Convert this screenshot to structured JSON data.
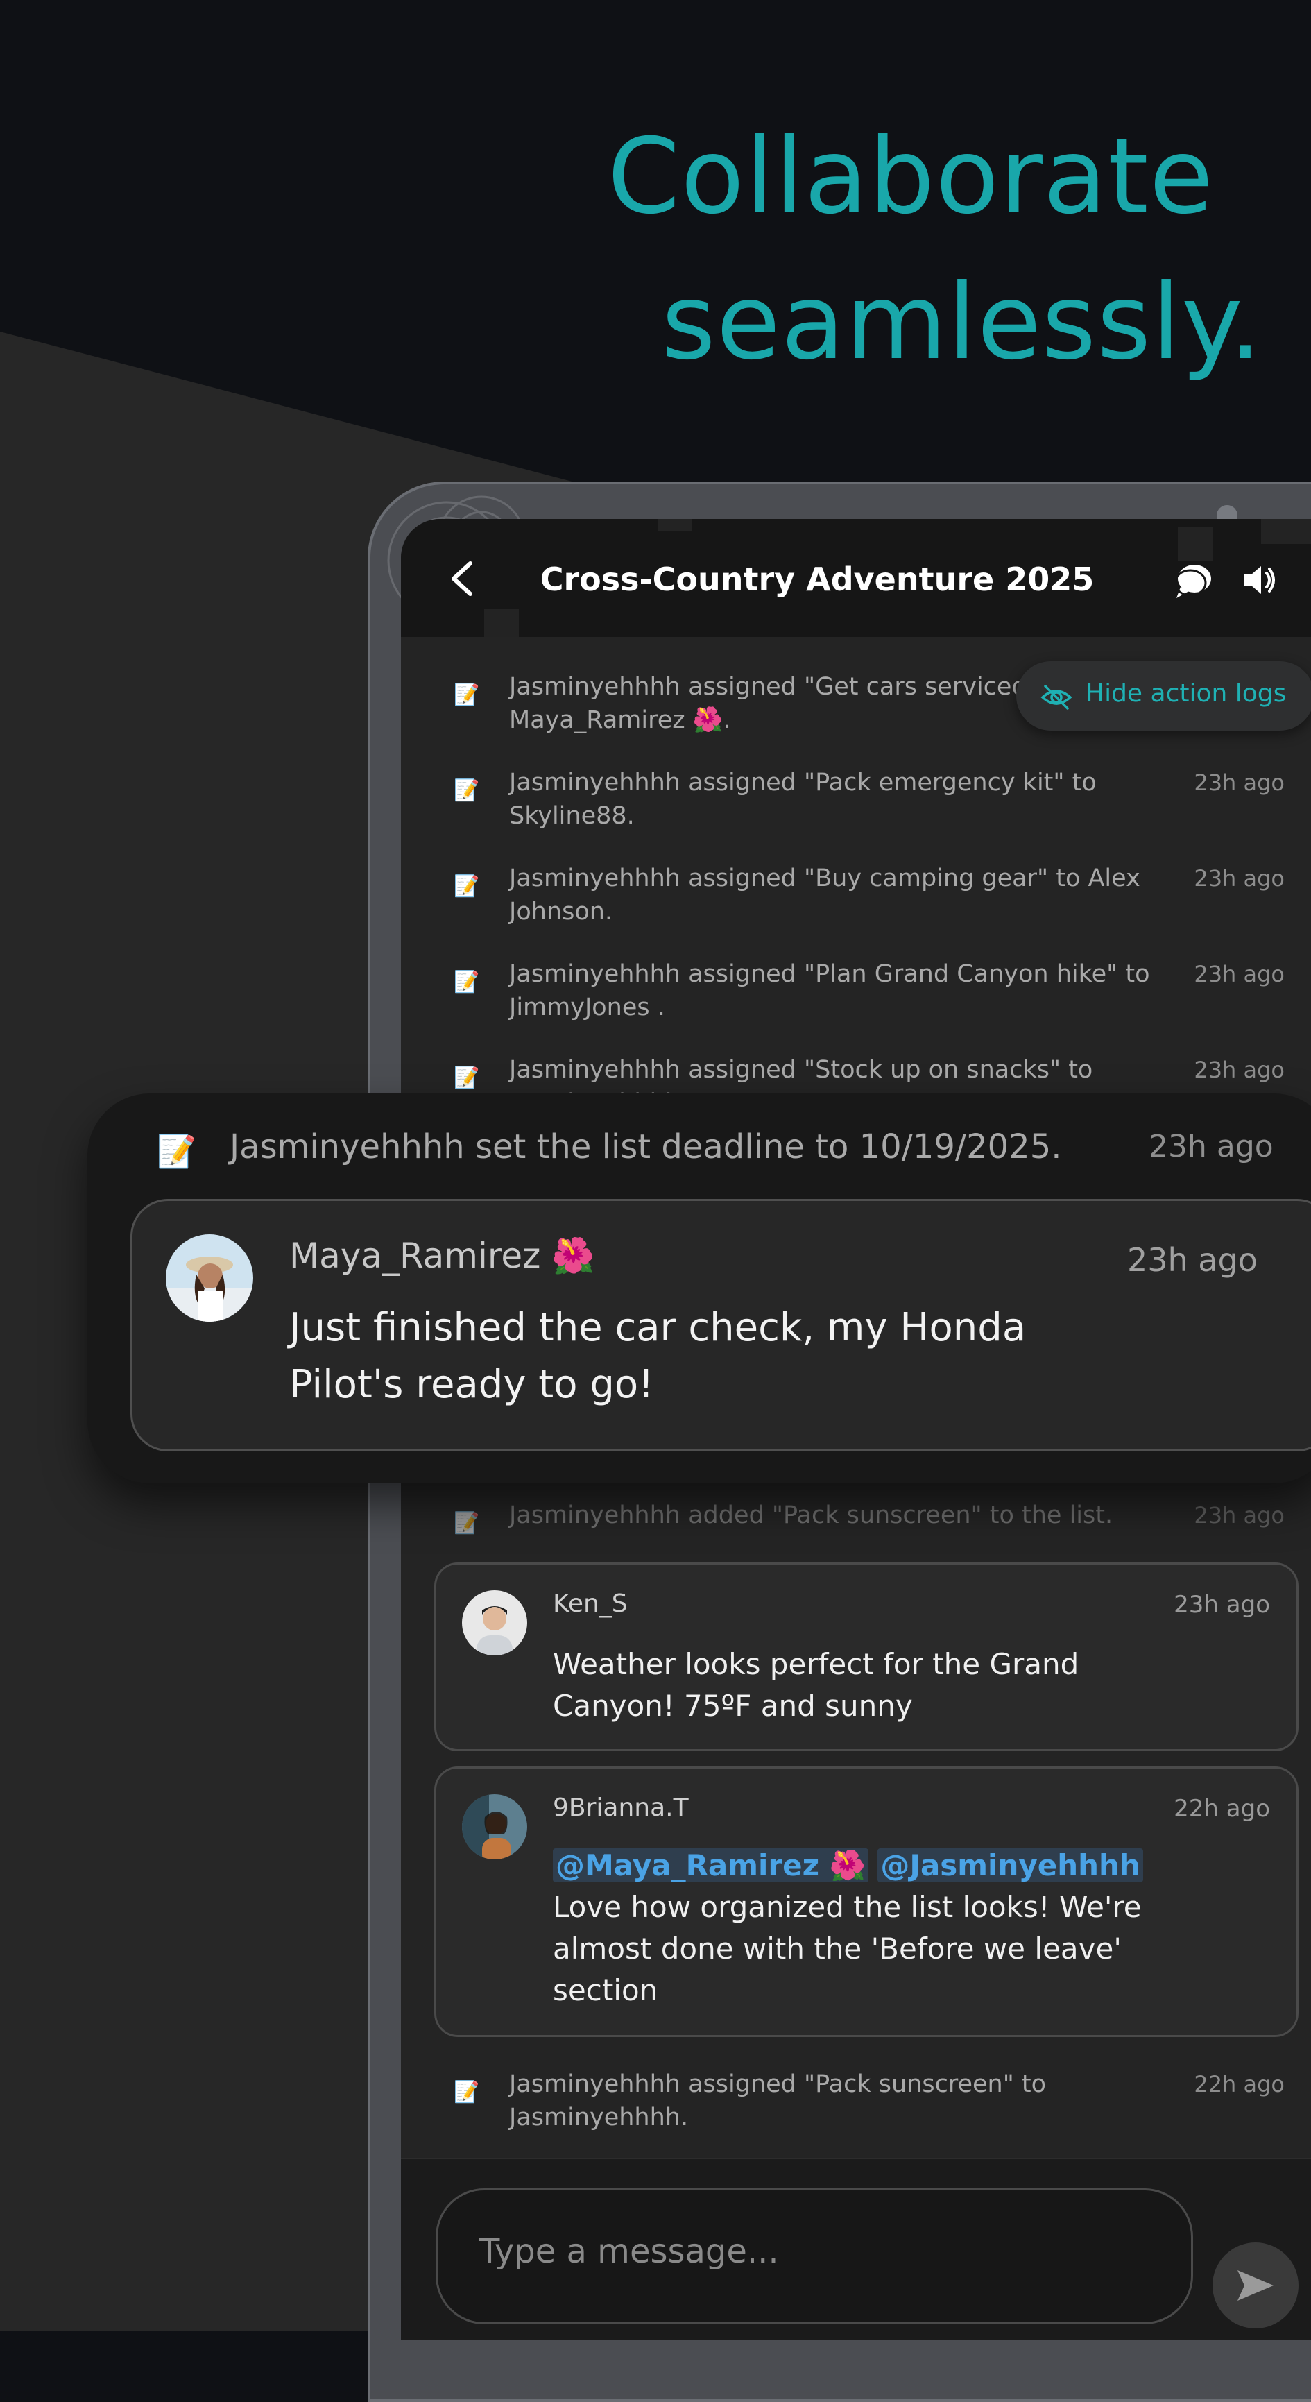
{
  "headline": {
    "line1": "Collaborate",
    "line2": "seamlessly."
  },
  "chat": {
    "title": "Cross-Country Adventure 2025",
    "hide_logs_label": "Hide action logs",
    "logs": [
      {
        "icon": "📝",
        "text": "Jasminyehhhh assigned \"Get cars serviced\" to Maya_Ramirez 🌺.",
        "time": ""
      },
      {
        "icon": "📝",
        "text": "Jasminyehhhh assigned \"Pack emergency kit\" to Skyline88.",
        "time": "23h ago"
      },
      {
        "icon": "📝",
        "text": "Jasminyehhhh assigned \"Buy camping gear\" to Alex Johnson.",
        "time": "23h ago"
      },
      {
        "icon": "📝",
        "text": "Jasminyehhhh assigned \"Plan Grand Canyon hike\" to JimmyJones .",
        "time": "23h ago"
      },
      {
        "icon": "📝",
        "text": "Jasminyehhhh assigned \"Stock up on snacks\" to Jasminyehhhh.",
        "time": "23h ago"
      }
    ],
    "zoom": {
      "log_icon": "📝",
      "log_text": "Jasminyehhhh set the list deadline to 10/19/2025.",
      "log_time": "23h ago",
      "user": "Maya_Ramirez 🌺",
      "time": "23h ago",
      "message": "Just finished the car check, my Honda Pilot's ready to go!"
    },
    "dim_log": {
      "icon": "📝",
      "text": "Jasminyehhhh added \"Pack sunscreen\" to the list.",
      "time": "23h ago"
    },
    "messages": [
      {
        "user": "Ken_S",
        "time": "23h ago",
        "text": "Weather looks perfect for the Grand Canyon! 75ºF and sunny"
      },
      {
        "user": "9Brianna.T",
        "time": "22h ago",
        "mention1": "@Maya_Ramirez 🌺",
        "mention2": "@Jasminyehhhh",
        "text": "Love how organized the list looks! We're almost done with the 'Before we leave' section"
      }
    ],
    "last_log": {
      "icon": "📝",
      "text": "Jasminyehhhh assigned \"Pack sunscreen\" to Jasminyehhhh.",
      "time": "22h ago"
    },
    "composer_placeholder": "Type a message..."
  },
  "colors": {
    "accent": "#19a7aa",
    "mention": "#4aa3e6",
    "background": "#0f1115"
  }
}
